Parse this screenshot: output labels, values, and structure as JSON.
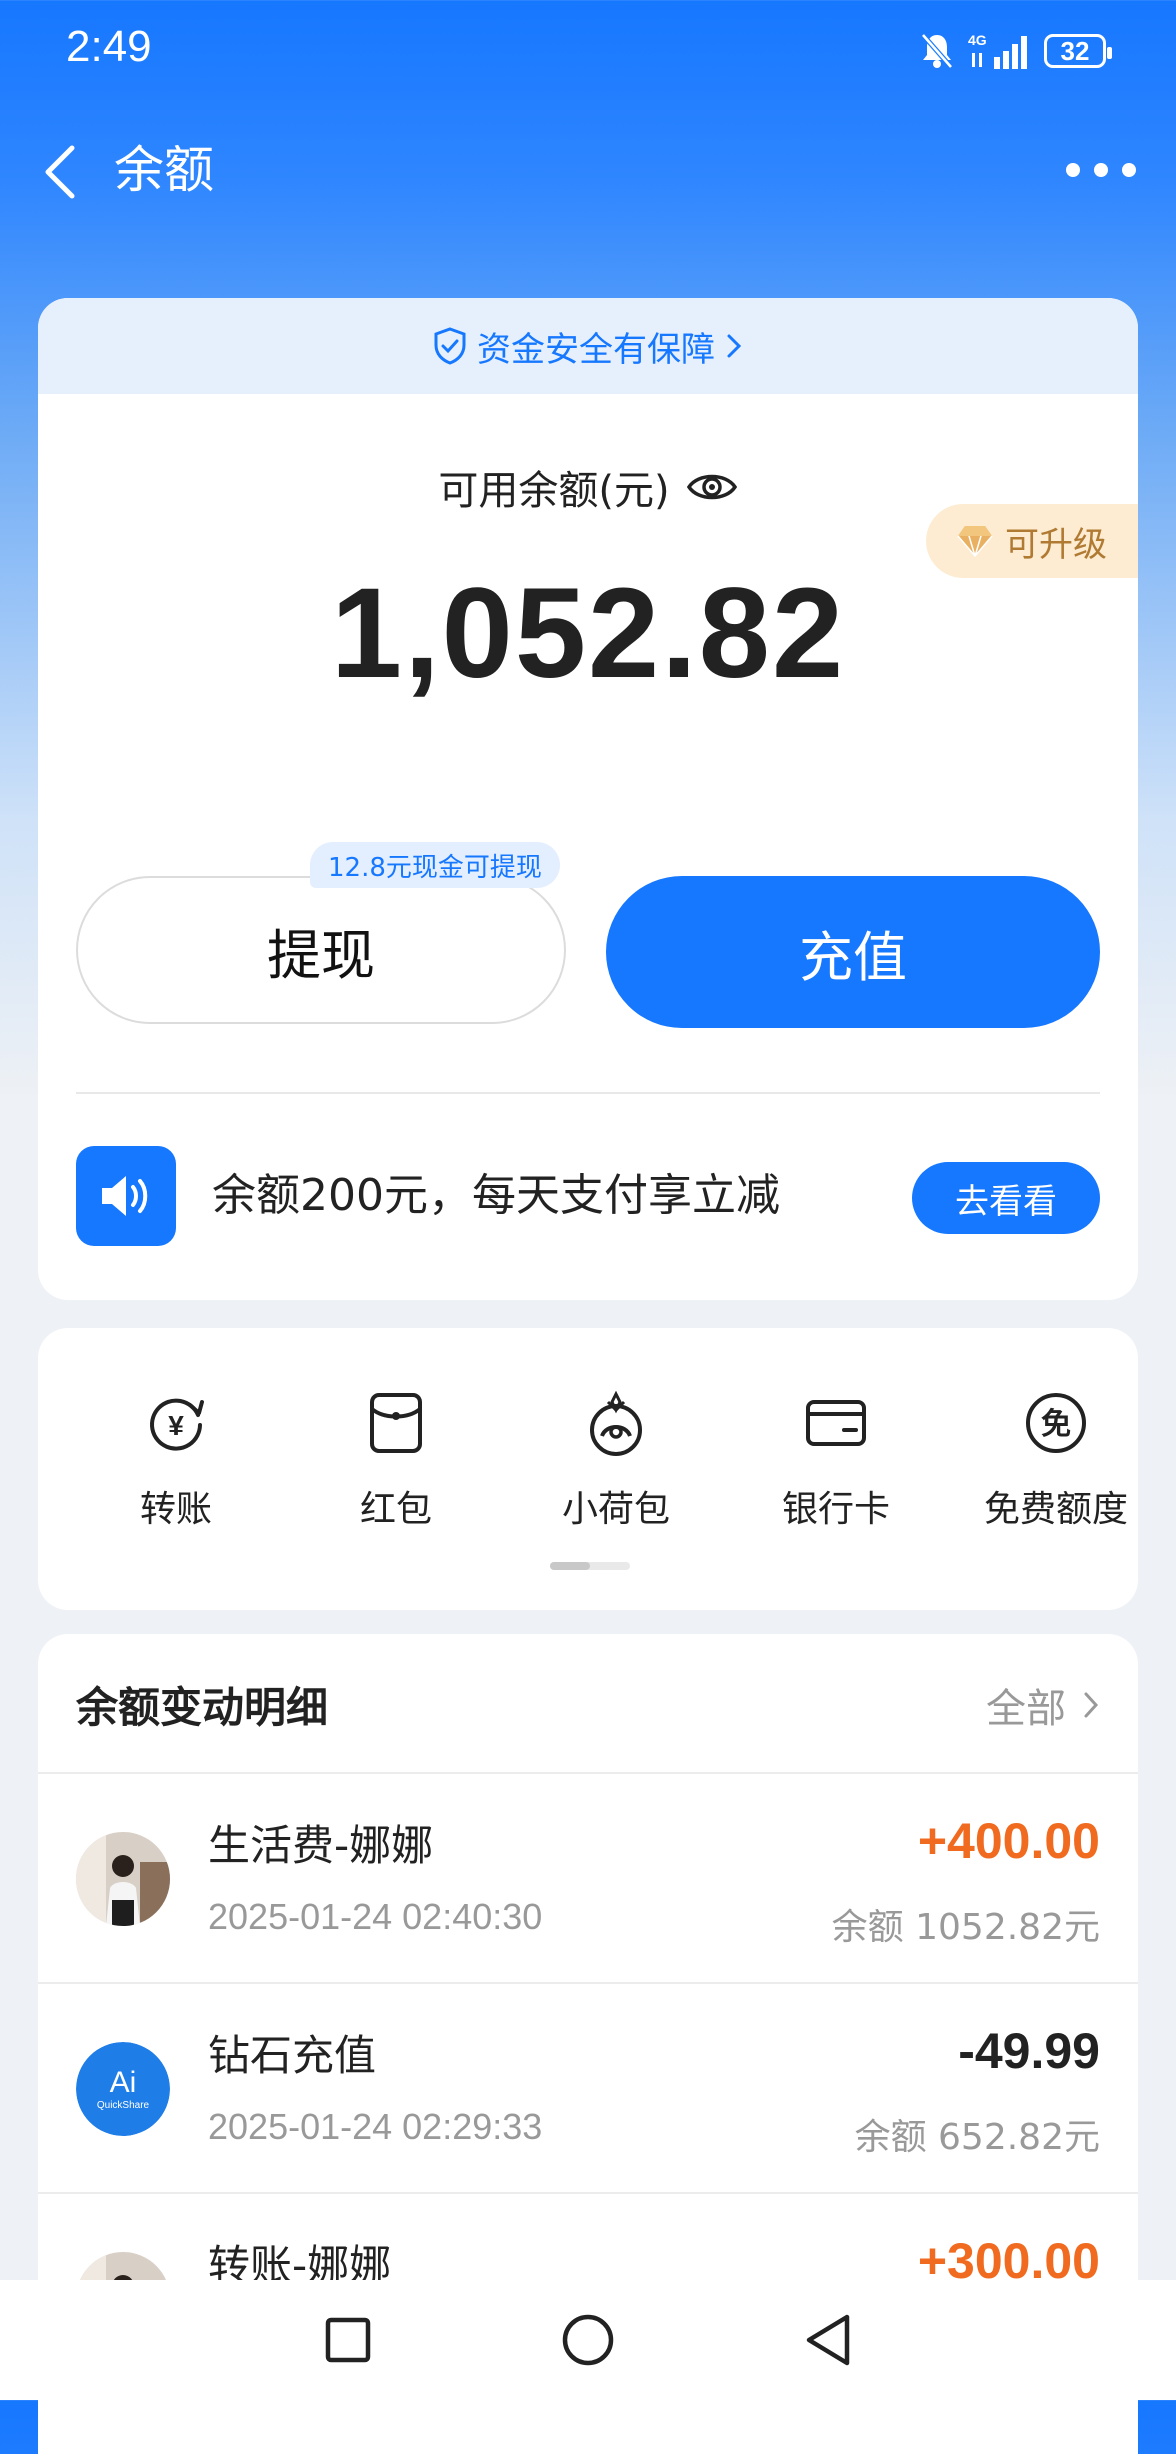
{
  "status_bar": {
    "time": "2:49",
    "network": "4G",
    "battery": "32"
  },
  "header": {
    "title": "余额"
  },
  "main_card": {
    "safety_text": "资金安全有保障",
    "balance_label": "可用余额(元)",
    "balance_amount": "1,052.82",
    "upgrade_label": "可升级",
    "withdraw_tip": "12.8元现金可提现",
    "withdraw_label": "提现",
    "recharge_label": "充值",
    "promo_text": "余额200元，每天支付享立减",
    "promo_button": "去看看"
  },
  "actions": [
    {
      "label": "转账",
      "icon": "transfer-icon"
    },
    {
      "label": "红包",
      "icon": "red-packet-icon"
    },
    {
      "label": "小荷包",
      "icon": "small-purse-icon"
    },
    {
      "label": "银行卡",
      "icon": "bank-card-icon"
    },
    {
      "label": "免费额度",
      "icon": "free-quota-icon"
    }
  ],
  "transactions": {
    "title": "余额变动明细",
    "all_label": "全部",
    "items": [
      {
        "name": "生活费-娜娜",
        "time": "2025-01-24 02:40:30",
        "amount": "+400.00",
        "balance": "余额 1052.82元"
      },
      {
        "name": "钻石充值",
        "time": "2025-01-24 02:29:33",
        "amount": "-49.99",
        "balance": "余额 652.82元"
      },
      {
        "name": "转账-娜娜",
        "time": "",
        "amount": "+300.00",
        "balance": ""
      }
    ]
  },
  "colors": {
    "primary": "#1677ff",
    "income": "#f06b1f",
    "upgrade": "#b17a33"
  }
}
